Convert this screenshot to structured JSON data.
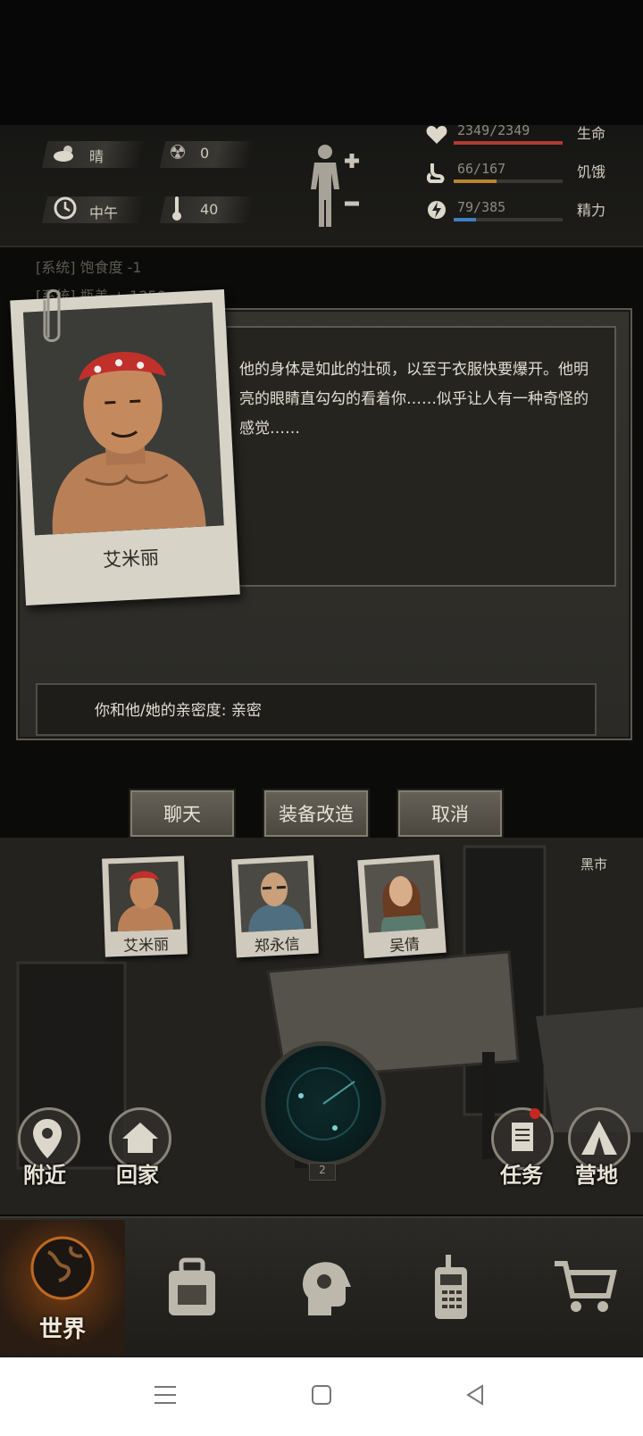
{
  "status": {
    "weather": "晴",
    "radiation": "0",
    "time_of_day": "中午",
    "temperature": "40",
    "health": {
      "value": "2349/2349",
      "label": "生命",
      "fraction": 1.0,
      "color": "#b23a34"
    },
    "hunger": {
      "value": "66/167",
      "label": "饥饿",
      "fraction": 0.395,
      "color": "#b8862e"
    },
    "stamina": {
      "value": "79/385",
      "label": "精力",
      "fraction": 0.205,
      "color": "#3d7fc2"
    }
  },
  "log": {
    "line1": "[系统] 饱食度 -1",
    "line2": "[系统] 瓶盖 + 1250"
  },
  "dialog": {
    "character_name": "艾米丽",
    "description": "他的身体是如此的壮硕，以至于衣服快要爆开。他明亮的眼睛直勾勾的看着你……似乎让人有一种奇怪的感觉……",
    "intimacy": "你和他/她的亲密度: 亲密",
    "buttons": {
      "chat": "聊天",
      "modify": "装备改造",
      "cancel": "取消"
    }
  },
  "scene": {
    "black_market": "黑市",
    "npcs": [
      "艾米丽",
      "郑永信",
      "吴倩"
    ],
    "radar_level": "2",
    "nearby": "附近",
    "home": "回家",
    "tasks": "任务",
    "camp": "营地"
  },
  "nav": {
    "world": "世界"
  }
}
